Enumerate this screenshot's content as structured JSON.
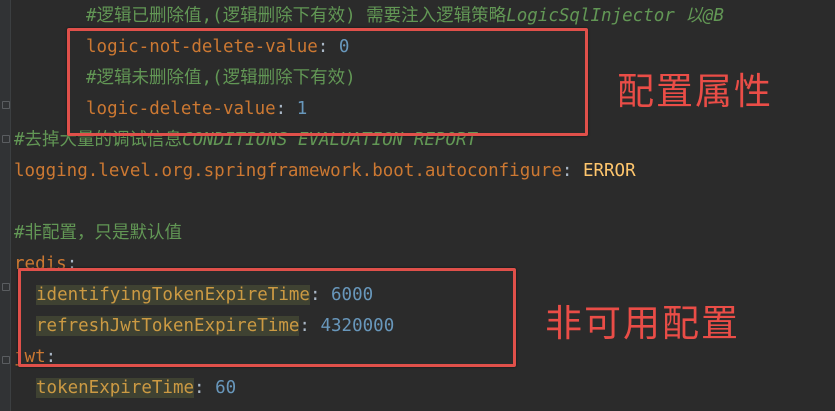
{
  "editor": {
    "lines": {
      "l1_comment": "#逻辑已删除值,(逻辑删除下有效) 需要注入逻辑策略",
      "l1_italic": "LogicSqlInjector 以@B",
      "l2_key": "logic-not-delete-value",
      "l2_sep": ": ",
      "l2_val": "0",
      "l3_comment": "#逻辑未删除值,(逻辑删除下有效)",
      "l4_key": "logic-delete-value",
      "l4_sep": ": ",
      "l4_val": "1",
      "l5_comment": "#去掉大量的调试信息",
      "l5_italic": "CONDITIONS EVALUATION REPORT",
      "l6_key": "logging.level.org.springframework.boot.autoconfigure",
      "l6_sep": ": ",
      "l6_val": "ERROR",
      "l8_comment": "#非配置，只是默认值",
      "l9_key": "redis",
      "l9_sep": ":",
      "l10_key": "identifyingTokenExpireTime",
      "l10_sep": ": ",
      "l10_val": "6000",
      "l11_key": "refreshJwtTokenExpireTime",
      "l11_sep": ": ",
      "l11_val": "4320000",
      "l12_key": "jwt",
      "l12_sep": ":",
      "l13_key": "tokenExpireTime",
      "l13_sep": ": ",
      "l13_val": "60"
    }
  },
  "annotations": {
    "top": "配置属性",
    "bottom": "非可用配置"
  },
  "colors": {
    "box": "#e0504a",
    "annotation": "#ea4d47",
    "background": "#2b2b2b"
  }
}
